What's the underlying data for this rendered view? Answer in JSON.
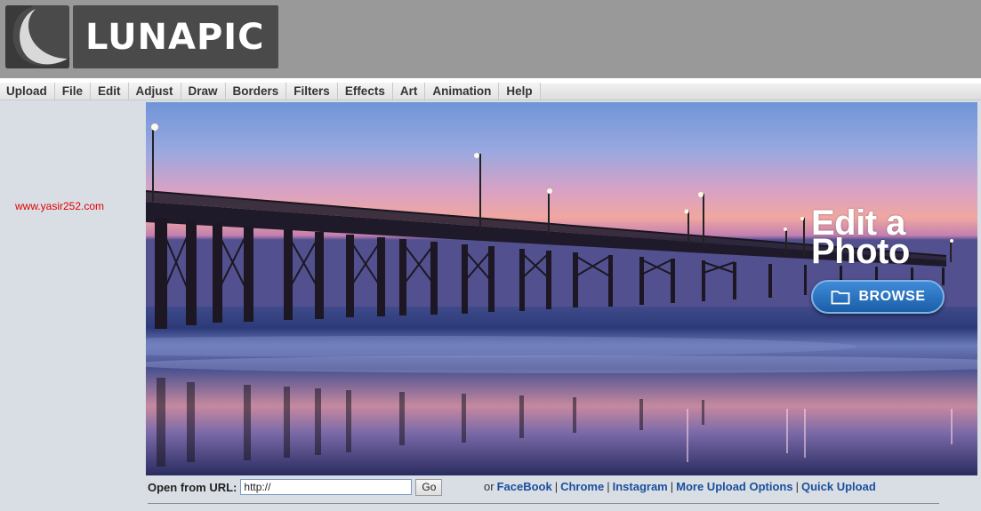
{
  "logo": {
    "text": "LUNAPIC",
    "mark_icon": "crescent-moon-icon"
  },
  "menu": {
    "items": [
      {
        "label": "Upload"
      },
      {
        "label": "File"
      },
      {
        "label": "Edit"
      },
      {
        "label": "Adjust"
      },
      {
        "label": "Draw"
      },
      {
        "label": "Borders"
      },
      {
        "label": "Filters"
      },
      {
        "label": "Effects"
      },
      {
        "label": "Art"
      },
      {
        "label": "Animation"
      },
      {
        "label": "Help"
      }
    ]
  },
  "watermark": "www.yasir252.com",
  "hero": {
    "title_line1": "Edit a",
    "title_line2": "Photo",
    "browse_label": "BROWSE",
    "browse_icon": "folder-icon"
  },
  "url_row": {
    "label": "Open from URL:",
    "input_value": "http://",
    "go_label": "Go"
  },
  "links": {
    "prefix": "or",
    "items": [
      {
        "label": "FaceBook"
      },
      {
        "label": "Chrome"
      },
      {
        "label": "Instagram"
      },
      {
        "label": "More Upload Options"
      },
      {
        "label": "Quick Upload"
      }
    ],
    "separator": "|"
  },
  "colors": {
    "header_bg": "#999999",
    "logo_bg": "#4a4a4a",
    "page_bg": "#d9dee5",
    "link": "#1a4f9c",
    "watermark": "#e00000",
    "browse_button": "#2a70c0"
  }
}
